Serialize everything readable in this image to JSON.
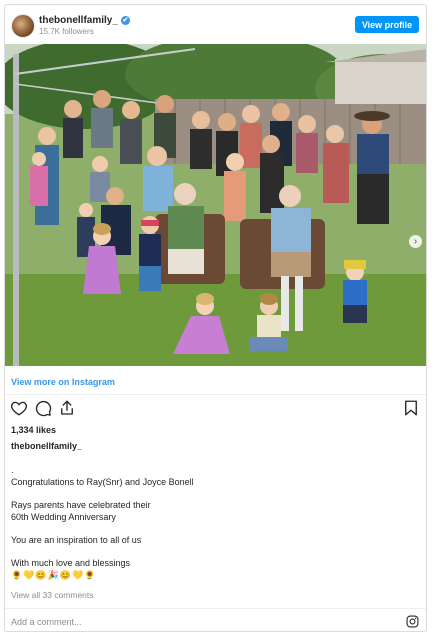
{
  "header": {
    "username": "thebonellfamily_",
    "verified_mark": "✔",
    "followers": "15.7K followers",
    "view_profile_label": "View profile"
  },
  "photo": {
    "description_icon": "family-photo",
    "next_arrow": "›"
  },
  "view_more_label": "View more on Instagram",
  "actions": {
    "like_icon": "heart-icon",
    "comment_icon": "comment-icon",
    "share_icon": "share-icon",
    "save_icon": "bookmark-icon"
  },
  "likes": "1,334 likes",
  "caption": {
    "username": "thebonellfamily_",
    "lines": [
      ".",
      "Congratulations to Ray(Snr) and Joyce Bonell",
      "",
      "Rays parents have celebrated their\n60th Wedding Anniversary",
      "",
      "You are an inspiration to all of us",
      "",
      "With much love and blessings",
      "🌻💛😊🎉😊💛🌻"
    ]
  },
  "comments_link": "View all 33 comments",
  "comment_placeholder": "Add a comment...",
  "colors": {
    "accent": "#0095f6",
    "link": "#3897f0",
    "muted": "#8e8e8e"
  }
}
